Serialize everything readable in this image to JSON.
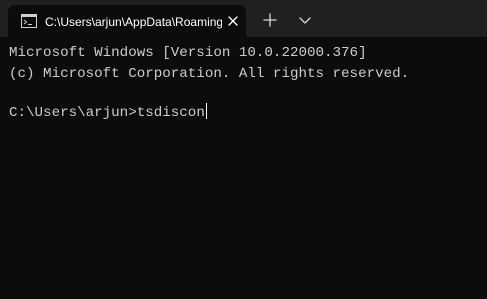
{
  "tab": {
    "title": "C:\\Users\\arjun\\AppData\\Roaming\\Microsoft\\Windows\\Start Menu",
    "icon": "terminal-icon"
  },
  "terminal": {
    "line1": "Microsoft Windows [Version 10.0.22000.376]",
    "line2": "(c) Microsoft Corporation. All rights reserved.",
    "prompt": "C:\\Users\\arjun>",
    "input": "tsdiscon"
  },
  "colors": {
    "titlebar": "#202020",
    "background": "#0c0c0c",
    "text": "#cccccc"
  }
}
